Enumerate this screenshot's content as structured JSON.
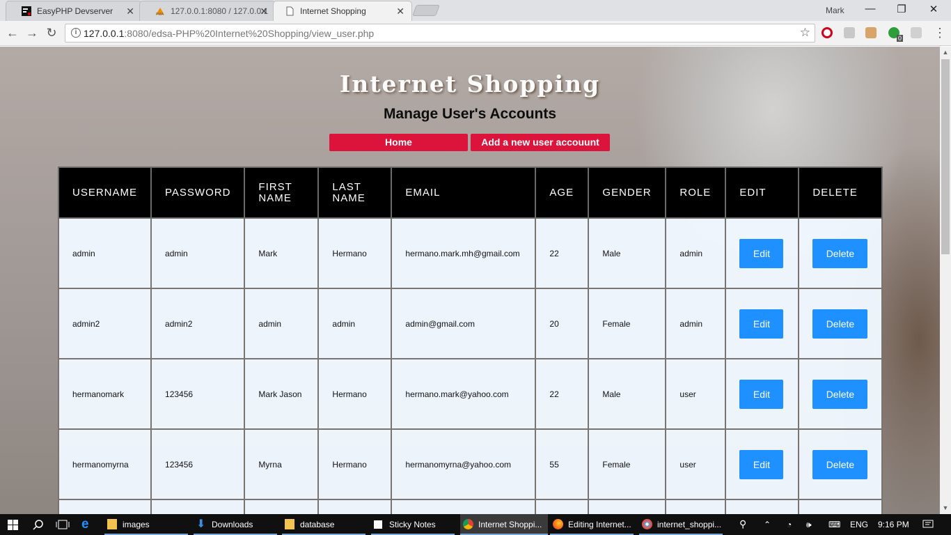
{
  "browser": {
    "tabs": [
      {
        "title": "EasyPHP Devserver"
      },
      {
        "title": "127.0.0.1:8080 / 127.0.0.1"
      },
      {
        "title": "Internet Shopping"
      }
    ],
    "profile_name": "Mark",
    "url_host": "127.0.0.1",
    "url_rest": ":8080/edsa-PHP%20Internet%20Shopping/view_user.php",
    "ext_badge": "0"
  },
  "page": {
    "site_title": "Internet Shopping",
    "heading": "Manage User's Accounts",
    "nav": {
      "home": "Home",
      "add_user": "Add a new user accouunt"
    },
    "columns": [
      "USERNAME",
      "PASSWORD",
      "FIRST NAME",
      "LAST NAME",
      "EMAIL",
      "AGE",
      "GENDER",
      "ROLE",
      "EDIT",
      "DELETE"
    ],
    "rows": [
      {
        "username": "admin",
        "password": "admin",
        "first_name": "Mark",
        "last_name": "Hermano",
        "email": "hermano.mark.mh@gmail.com",
        "age": "22",
        "gender": "Male",
        "role": "admin"
      },
      {
        "username": "admin2",
        "password": "admin2",
        "first_name": "admin",
        "last_name": "admin",
        "email": "admin@gmail.com",
        "age": "20",
        "gender": "Female",
        "role": "admin"
      },
      {
        "username": "hermanomark",
        "password": "123456",
        "first_name": "Mark Jason",
        "last_name": "Hermano",
        "email": "hermano.mark@yahoo.com",
        "age": "22",
        "gender": "Male",
        "role": "user"
      },
      {
        "username": "hermanomyrna",
        "password": "123456",
        "first_name": "Myrna",
        "last_name": "Hermano",
        "email": "hermanomyrna@yahoo.com",
        "age": "55",
        "gender": "Female",
        "role": "user"
      }
    ],
    "edit_label": "Edit",
    "delete_label": "Delete"
  },
  "taskbar": {
    "items": [
      {
        "label": "images"
      },
      {
        "label": "Downloads"
      },
      {
        "label": "database"
      },
      {
        "label": "Sticky Notes"
      },
      {
        "label": "Internet Shoppi..."
      },
      {
        "label": "Editing Internet..."
      },
      {
        "label": "internet_shoppi..."
      }
    ],
    "lang": "ENG",
    "time": "9:16 PM"
  }
}
